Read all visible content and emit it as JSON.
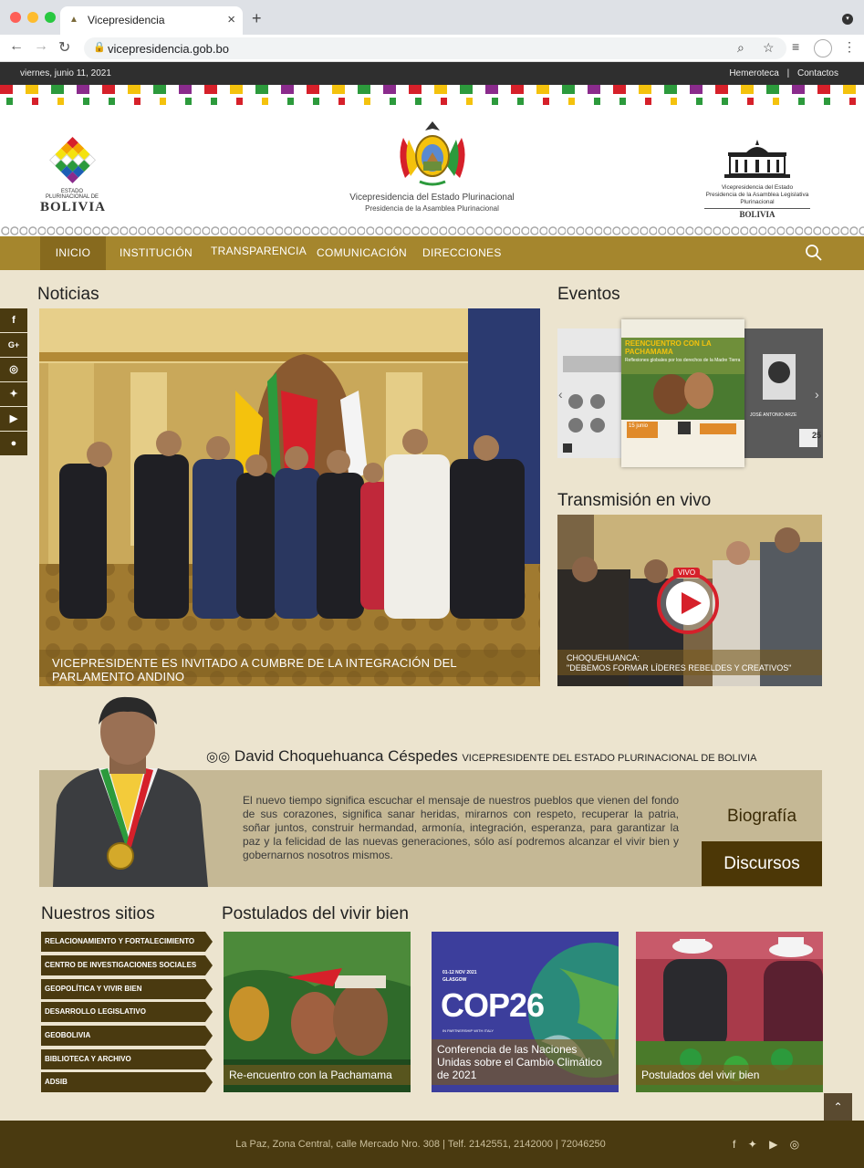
{
  "browser": {
    "tab_title": "Vicepresidencia",
    "url": "vicepresidencia.gob.bo"
  },
  "topbar": {
    "date": "viernes, junio 11, 2021",
    "links": [
      "Hemeroteca",
      "|",
      "Contactos"
    ]
  },
  "header": {
    "left_logo_small": "ESTADO PLURINACIONAL DE",
    "left_logo_big": "BOLIVIA",
    "center_title": "Vicepresidencia del Estado Plurinacional",
    "center_subtitle": "Presidencia de la Asamblea Plurinacional",
    "right_line1": "Vicepresidencia del Estado",
    "right_line2": "Presidencia de la Asamblea Legislativa Plurinacional",
    "right_line3": "BOLIVIA"
  },
  "nav": {
    "items": [
      "INICIO",
      "INSTITUCIÓN",
      "TRANSPARENCIA",
      "COMUNICACIÓN",
      "DIRECCIONES"
    ]
  },
  "social": [
    "f",
    "G+",
    "ig",
    "tw",
    "yt",
    "sp"
  ],
  "noticias": {
    "title": "Noticias",
    "caption": "VICEPRESIDENTE ES INVITADO A CUMBRE DE LA INTEGRACIÓN DEL PARLAMENTO ANDINO"
  },
  "eventos": {
    "title": "Eventos",
    "poster_main_title": "REENCUENTRO CON LA PACHAMAMA",
    "poster_main_sub": "Reflexiones globales por los derechos de la Madre Tierra",
    "poster_main_date": "15 junio",
    "poster_right_name": "JOSÉ ANTONIO ARZE",
    "poster_right_date": "25"
  },
  "transmision": {
    "title": "Transmisión en vivo",
    "live_badge": "VIVO",
    "caption_line1": "CHOQUEHUANCA:",
    "caption_line2": "\"DEBEMOS FORMAR LÍDERES REBELDES Y CREATIVOS\""
  },
  "vp": {
    "name": "David Choquehuanca Céspedes",
    "role": "VICEPRESIDENTE DEL ESTADO PLURINACIONAL DE BOLIVIA",
    "quote": "El nuevo tiempo significa escuchar el mensaje de nuestros pueblos que vienen del fondo de sus corazones, significa sanar heridas, mirarnos con respeto, recuperar la patria, soñar juntos, construir hermandad, armonía, integración, esperanza, para garantizar la paz y la felicidad de las nuevas generaciones, sólo así podremos alcanzar el vivir bien y gobernarnos nosotros mismos.",
    "bio_label": "Biografía",
    "discursos_label": "Discursos"
  },
  "sitios": {
    "title": "Nuestros sitios",
    "items": [
      "RELACIONAMIENTO Y FORTALECIMIENTO",
      "CENTRO DE INVESTIGACIONES SOCIALES",
      "GEOPOLÍTICA Y VIVIR BIEN",
      "DESARROLLO LEGISLATIVO",
      "GEOBOLIVIA",
      "BIBLIOTECA Y ARCHIVO",
      "ADSIB"
    ]
  },
  "postulados": {
    "title": "Postulados del vivir bien",
    "cards": [
      {
        "caption": "Re-encuentro con la Pachamama"
      },
      {
        "caption": "Conferencia de las Naciones Unidas sobre el Cambio Climático de 2021",
        "dates": "01-12 NOV 2021",
        "city": "GLASGOW",
        "big": "COP26",
        "partner": "IN PARTNERSHIP WITH ITALY"
      },
      {
        "caption": "Postulados del vivir bien"
      }
    ]
  },
  "footer": {
    "address": "La Paz, Zona Central, calle Mercado Nro. 308 | Telf. 2142551, 2142000 | 72046250"
  },
  "colors": {
    "nav": "#a5862d",
    "dark_brown": "#4a3a10",
    "page_bg": "#ece4cf"
  }
}
